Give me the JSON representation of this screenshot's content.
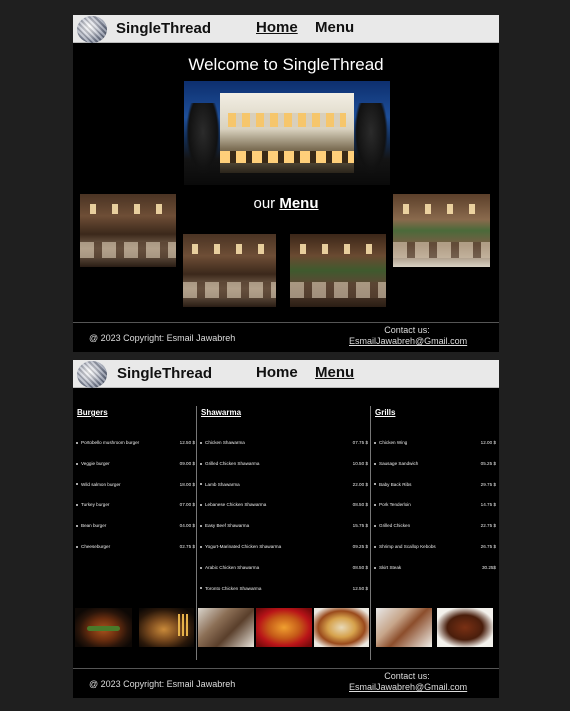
{
  "nav": {
    "brand": "SingleThread",
    "home": "Home",
    "menu": "Menu"
  },
  "home": {
    "welcome": "Welcome to SingleThread",
    "our": "our",
    "menu_link": "Menu"
  },
  "footer": {
    "copyright": "@ 2023 Copyright: Esmail Jawabreh",
    "contact_label": "Contact us:",
    "contact_email": "EsmailJawabreh@Gmail.com"
  },
  "menu": {
    "burgers": {
      "title": "Burgers",
      "items": [
        {
          "name": "Portobello mushroom burger",
          "price": "12.50 $"
        },
        {
          "name": "Veggie burger",
          "price": "09.00 $"
        },
        {
          "name": "Wild salmon burger",
          "price": "18.00 $"
        },
        {
          "name": "Turkey burger",
          "price": "07.00 $"
        },
        {
          "name": "Bean burger",
          "price": "04.00 $"
        },
        {
          "name": "Cheeseburger",
          "price": "02.75 $"
        }
      ]
    },
    "shawarma": {
      "title": "Shawarma",
      "items": [
        {
          "name": "Chicken Shawarma",
          "price": "07.75 $"
        },
        {
          "name": "Grilled Chicken Shawarma",
          "price": "10.50 $"
        },
        {
          "name": "Lamb Shawarma",
          "price": "22.00 $"
        },
        {
          "name": "Lebanese Chicken Shawarma",
          "price": "08.50 $"
        },
        {
          "name": "Easy Beef Shawarma",
          "price": "15.75 $"
        },
        {
          "name": "Yogurt-Marinated Chicken Shawarma",
          "price": "09.25 $"
        },
        {
          "name": "Arabic Chicken Shawarma",
          "price": "08.50 $"
        },
        {
          "name": "Toronto Chicken Shawarma",
          "price": "12.50 $"
        }
      ]
    },
    "grills": {
      "title": "Grills",
      "items": [
        {
          "name": "Chicken Wing",
          "price": "12.00 $"
        },
        {
          "name": "Sausage Sandwich",
          "price": "05.25 $"
        },
        {
          "name": "Baby Back Ribs",
          "price": "29.75 $"
        },
        {
          "name": "Pork Tenderloin",
          "price": "14.75 $"
        },
        {
          "name": "Grilled Chicken",
          "price": "22.75 $"
        },
        {
          "name": "Shrimp and Scallop Kebobs",
          "price": "26.75 $"
        },
        {
          "name": "Skirt Steak",
          "price": "30.25$"
        }
      ]
    }
  }
}
